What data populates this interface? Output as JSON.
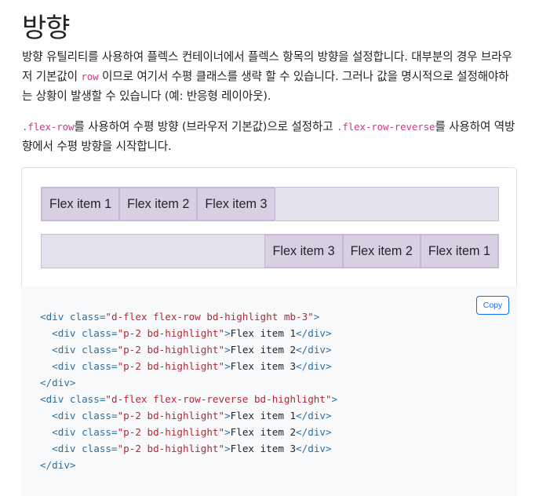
{
  "page": {
    "title": "방향",
    "intro": {
      "before": "방향 유틸리티를 사용하여 플렉스 컨테이너에서 플렉스 항목의 방향을 설정합니다. 대부분의 경우 브라우저 기본값이 ",
      "code": "row",
      "after": " 이므로 여기서 수평 클래스를 생략 할 수 있습니다. 그러나 값을 명시적으로 설정해야하는 상황이 발생할 수 있습니다 (예: 반응형 레이아웃)."
    },
    "desc": {
      "code1": ".flex-row",
      "text1": "를 사용하여 수평 방향 (브라우저 기본값)으로 설정하고 ",
      "code2": ".flex-row-reverse",
      "text2": "를 사용하여 역방향에서 수평 방향을 시작합니다."
    }
  },
  "example": {
    "row": [
      "Flex item 1",
      "Flex item 2",
      "Flex item 3"
    ],
    "row_reverse": [
      "Flex item 1",
      "Flex item 2",
      "Flex item 3"
    ]
  },
  "code_block": {
    "copy_label": "Copy",
    "lines": [
      {
        "indent": "",
        "open": "<div",
        "attr": " class=",
        "val": "\"d-flex flex-row bd-highlight mb-3\"",
        "gt": ">",
        "text": "",
        "close": ""
      },
      {
        "indent": "  ",
        "open": "<div",
        "attr": " class=",
        "val": "\"p-2 bd-highlight\"",
        "gt": ">",
        "text": "Flex item 1",
        "close": "</div>"
      },
      {
        "indent": "  ",
        "open": "<div",
        "attr": " class=",
        "val": "\"p-2 bd-highlight\"",
        "gt": ">",
        "text": "Flex item 2",
        "close": "</div>"
      },
      {
        "indent": "  ",
        "open": "<div",
        "attr": " class=",
        "val": "\"p-2 bd-highlight\"",
        "gt": ">",
        "text": "Flex item 3",
        "close": "</div>"
      },
      {
        "indent": "",
        "open": "</div>",
        "attr": "",
        "val": "",
        "gt": "",
        "text": "",
        "close": ""
      },
      {
        "indent": "",
        "open": "<div",
        "attr": " class=",
        "val": "\"d-flex flex-row-reverse bd-highlight\"",
        "gt": ">",
        "text": "",
        "close": ""
      },
      {
        "indent": "  ",
        "open": "<div",
        "attr": " class=",
        "val": "\"p-2 bd-highlight\"",
        "gt": ">",
        "text": "Flex item 1",
        "close": "</div>"
      },
      {
        "indent": "  ",
        "open": "<div",
        "attr": " class=",
        "val": "\"p-2 bd-highlight\"",
        "gt": ">",
        "text": "Flex item 2",
        "close": "</div>"
      },
      {
        "indent": "  ",
        "open": "<div",
        "attr": " class=",
        "val": "\"p-2 bd-highlight\"",
        "gt": ">",
        "text": "Flex item 3",
        "close": "</div>"
      },
      {
        "indent": "",
        "open": "</div>",
        "attr": "",
        "val": "",
        "gt": "",
        "text": "",
        "close": ""
      }
    ]
  }
}
